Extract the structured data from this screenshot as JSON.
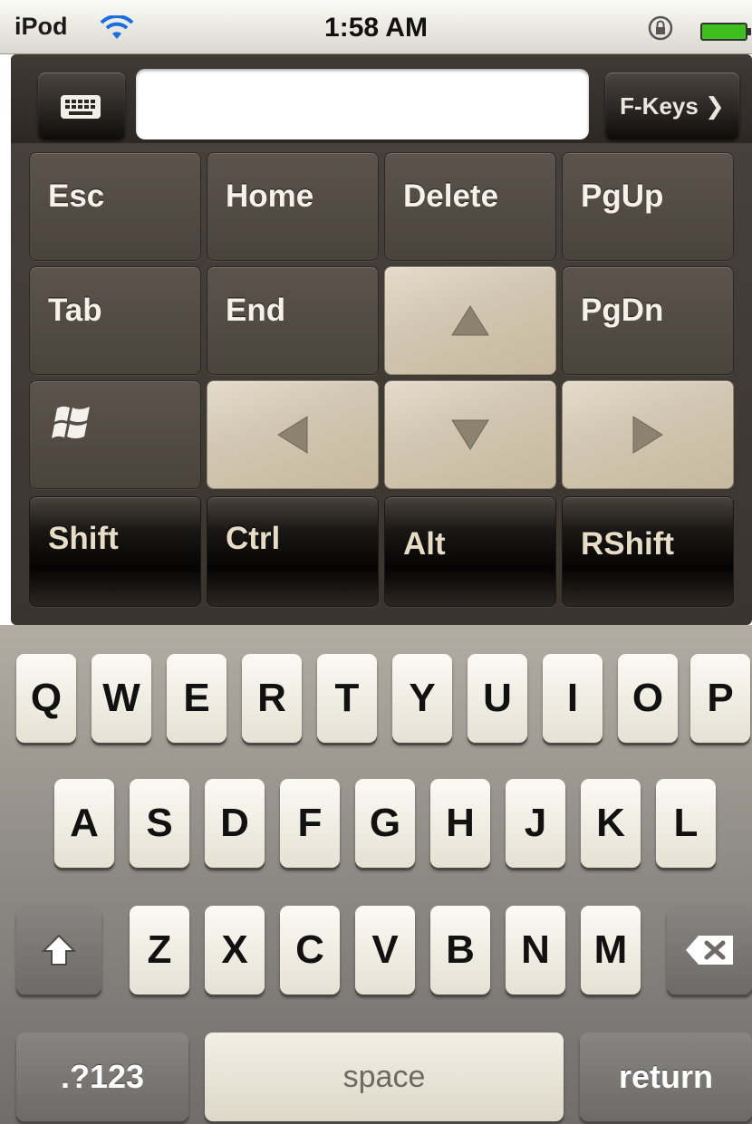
{
  "status_bar": {
    "carrier": "iPod",
    "time": "1:58 AM",
    "wifi_icon": "wifi-icon",
    "lock_icon": "orientation-lock-icon",
    "battery_icon": "battery-icon",
    "battery_color": "#3fbf1f"
  },
  "remote": {
    "keyboard_toggle_icon": "keyboard-icon",
    "text_input_value": "",
    "fkeys_label": "F-Keys ❯",
    "row1": [
      "Esc",
      "Home",
      "Delete",
      "PgUp"
    ],
    "row2": [
      "Tab",
      "End",
      "up-arrow",
      "PgDn"
    ],
    "row3": [
      "windows-logo",
      "left-arrow",
      "down-arrow",
      "right-arrow"
    ],
    "modifiers": [
      "Shift",
      "Ctrl",
      "Alt",
      "RShift"
    ]
  },
  "keyboard": {
    "row1": [
      "Q",
      "W",
      "E",
      "R",
      "T",
      "Y",
      "U",
      "I",
      "O",
      "P"
    ],
    "row2": [
      "A",
      "S",
      "D",
      "F",
      "G",
      "H",
      "J",
      "K",
      "L"
    ],
    "row3": [
      "Z",
      "X",
      "C",
      "V",
      "B",
      "N",
      "M"
    ],
    "shift_icon": "shift-arrow-icon",
    "backspace_icon": "backspace-icon",
    "numbers_label": ".?123",
    "space_label": "space",
    "return_label": "return"
  }
}
